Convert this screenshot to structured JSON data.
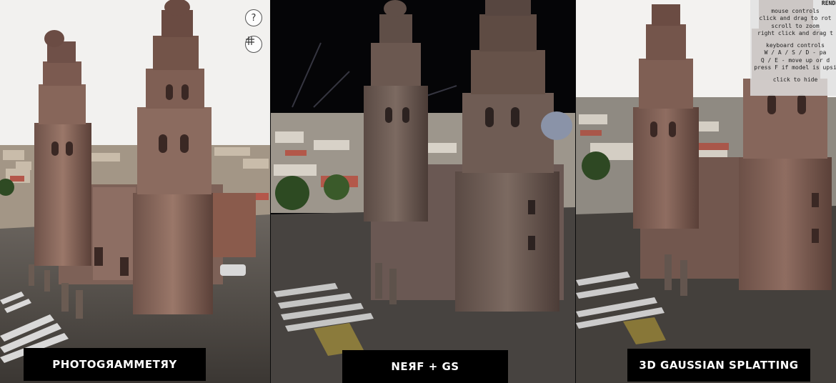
{
  "panels": [
    {
      "id": "photogrammetry",
      "caption": "PHOTOGЯAMMETЯY"
    },
    {
      "id": "nerf-gs",
      "caption": "NEЯF + GS"
    },
    {
      "id": "gaussian-splatting",
      "caption": "3D GAUSSIAN SPLATTING"
    }
  ],
  "viewer_buttons": {
    "help_label": "?",
    "help_icon": "question-icon",
    "grid_icon": "grid-icon"
  },
  "controls_overlay": {
    "title": "RENDE",
    "mouse_heading": "mouse controls",
    "mouse_line1": "click and drag to rot",
    "mouse_line2": "scroll to zoom",
    "mouse_line3": "right click and drag t",
    "keyboard_heading": "keyboard controls",
    "keyboard_line1": "W / A / S / D - pa",
    "keyboard_line2": "Q / E - move up or d",
    "keyboard_line3": "press F if model is upsi",
    "hide_hint": "click to hide"
  },
  "colors": {
    "sky_white": "#f2f1ef",
    "night_sky": "#050507",
    "stone": "#8a6a5e",
    "caption_bg": "#000000"
  }
}
